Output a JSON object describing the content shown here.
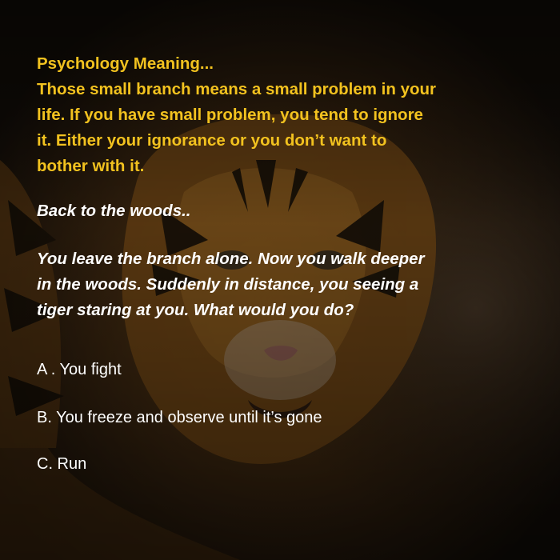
{
  "psychology": {
    "heading": "Psychology Meaning...",
    "lines": [
      "Those small branch means a small problem in your",
      "life. If you have small problem, you tend to ignore",
      "it. Either your ignorance or you don’t want to",
      "bother with it."
    ]
  },
  "story": {
    "back": "Back to the woods..",
    "lines": [
      "You leave the branch alone. Now you walk deeper",
      "in the woods.  Suddenly in distance, you seeing a",
      "tiger staring at you. What would you do?"
    ]
  },
  "options": [
    "A . You fight",
    "B. You freeze and observe until it’s gone",
    "C. Run"
  ],
  "colors": {
    "accent_text": "#f2c21f",
    "body_text": "#ffffff"
  },
  "background": {
    "subject": "tiger-image"
  }
}
